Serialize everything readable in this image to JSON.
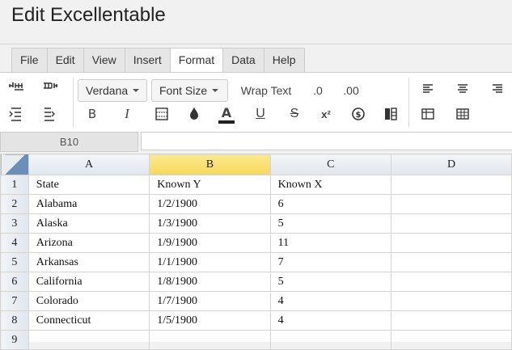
{
  "app": {
    "title": "Edit Excellentable"
  },
  "menu": {
    "items": [
      {
        "label": "File"
      },
      {
        "label": "Edit"
      },
      {
        "label": "View"
      },
      {
        "label": "Insert"
      },
      {
        "label": "Format"
      },
      {
        "label": "Data"
      },
      {
        "label": "Help"
      }
    ],
    "active": "Format"
  },
  "toolbar": {
    "font_family": "Verdana",
    "font_size": "Font Size",
    "wrap_text": "Wrap Text",
    "decrease_decimal": ".0",
    "increase_decimal": ".00",
    "bold": "B",
    "italic": "I",
    "text_color_letter": "A",
    "text_color": "#222222",
    "underline": "U",
    "strikethrough": "S",
    "superscript": "x²"
  },
  "formula_bar": {
    "cell_reference": "B10",
    "value": ""
  },
  "sheet": {
    "columns": [
      "A",
      "B",
      "C",
      "D"
    ],
    "selected_column": "B",
    "rows": [
      {
        "num": "1",
        "cells": [
          "State",
          "Known Y",
          "Known X",
          ""
        ]
      },
      {
        "num": "2",
        "cells": [
          "Alabama",
          "1/2/1900",
          "6",
          ""
        ]
      },
      {
        "num": "3",
        "cells": [
          "Alaska",
          "1/3/1900",
          "5",
          ""
        ]
      },
      {
        "num": "4",
        "cells": [
          "Arizona",
          "1/9/1900",
          "11",
          ""
        ]
      },
      {
        "num": "5",
        "cells": [
          "Arkansas",
          "1/1/1900",
          "7",
          ""
        ]
      },
      {
        "num": "6",
        "cells": [
          "California",
          "1/8/1900",
          "5",
          ""
        ]
      },
      {
        "num": "7",
        "cells": [
          "Colorado",
          "1/7/1900",
          "4",
          ""
        ]
      },
      {
        "num": "8",
        "cells": [
          "Connecticut",
          "1/5/1900",
          "4",
          ""
        ]
      },
      {
        "num": "9",
        "cells": [
          "",
          "",
          "",
          ""
        ]
      }
    ]
  }
}
